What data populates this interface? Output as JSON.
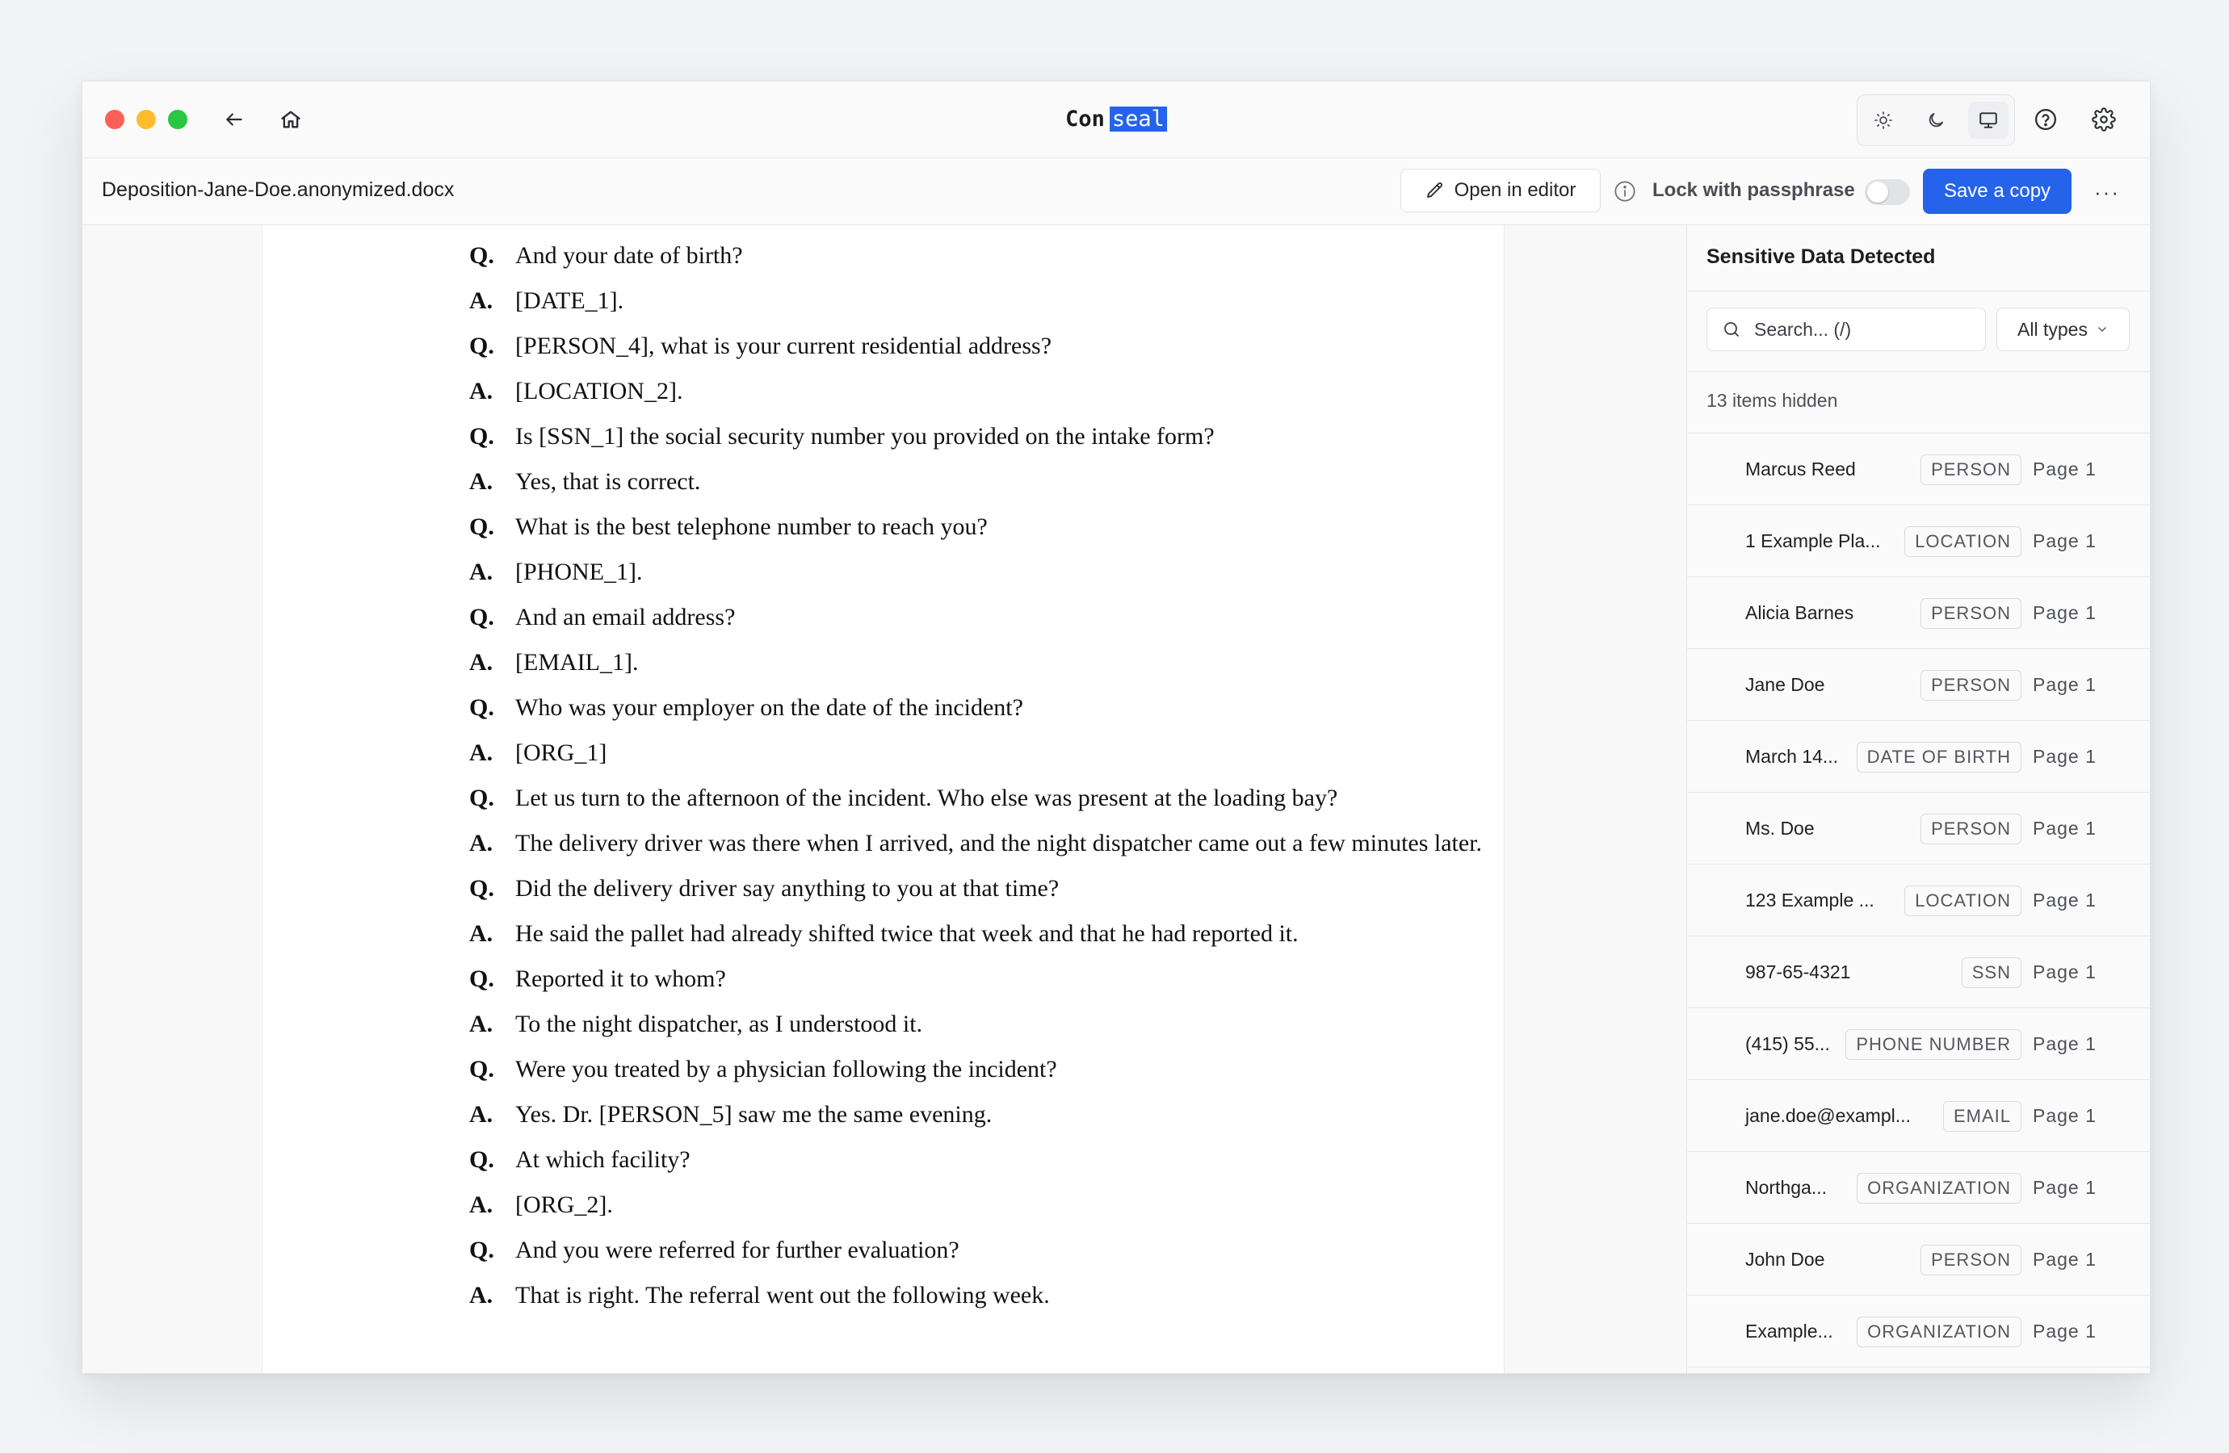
{
  "app": {
    "brand_left": "Con",
    "brand_right": "seal"
  },
  "toolbar": {
    "filename": "Deposition-Jane-Doe.anonymized.docx",
    "open_in_editor": "Open in editor",
    "lock_label": "Lock with passphrase",
    "lock_enabled": false,
    "save_copy": "Save a copy",
    "more": "···"
  },
  "document": {
    "lines": [
      {
        "marker": "Q.",
        "text": "And your date of birth?"
      },
      {
        "marker": "A.",
        "text": "[DATE_1]."
      },
      {
        "marker": "Q.",
        "text": "[PERSON_4], what is your current residential address?"
      },
      {
        "marker": "A.",
        "text": "[LOCATION_2]."
      },
      {
        "marker": "Q.",
        "text": "Is [SSN_1] the social security number you provided on the intake form?"
      },
      {
        "marker": "A.",
        "text": "Yes, that is correct."
      },
      {
        "marker": "Q.",
        "text": "What is the best telephone number to reach you?"
      },
      {
        "marker": "A.",
        "text": "[PHONE_1]."
      },
      {
        "marker": "Q.",
        "text": "And an email address?"
      },
      {
        "marker": "A.",
        "text": "[EMAIL_1]."
      },
      {
        "marker": "Q.",
        "text": "Who was your employer on the date of the incident?"
      },
      {
        "marker": "A.",
        "text": "[ORG_1]"
      },
      {
        "marker": "Q.",
        "text": "Let us turn to the afternoon of the incident. Who else was present at the loading bay?"
      },
      {
        "marker": "A.",
        "text": "The delivery driver was there when I arrived, and the night dispatcher came out a few minutes later."
      },
      {
        "marker": "Q.",
        "text": "Did the delivery driver say anything to you at that time?"
      },
      {
        "marker": "A.",
        "text": "He said the pallet had already shifted twice that week and that he had reported it."
      },
      {
        "marker": "Q.",
        "text": "Reported it to whom?"
      },
      {
        "marker": "A.",
        "text": "To the night dispatcher, as I understood it."
      },
      {
        "marker": "Q.",
        "text": "Were you treated by a physician following the incident?"
      },
      {
        "marker": "A.",
        "text": "Yes. Dr. [PERSON_5] saw me the same evening."
      },
      {
        "marker": "Q.",
        "text": "At which facility?"
      },
      {
        "marker": "A.",
        "text": "[ORG_2]."
      },
      {
        "marker": "Q.",
        "text": "And you were referred for further evaluation?"
      },
      {
        "marker": "A.",
        "text": "That is right. The referral went out the following week."
      }
    ]
  },
  "sidebar": {
    "title": "Sensitive Data Detected",
    "search_placeholder": "Search... (/)",
    "filter_label": "All types",
    "hidden_count": "13 items hidden",
    "items": [
      {
        "name": "Marcus Reed",
        "type": "PERSON",
        "page": "Page 1"
      },
      {
        "name": "1 Example Pla...",
        "type": "LOCATION",
        "page": "Page 1"
      },
      {
        "name": "Alicia Barnes",
        "type": "PERSON",
        "page": "Page 1"
      },
      {
        "name": "Jane Doe",
        "type": "PERSON",
        "page": "Page 1"
      },
      {
        "name": "March 14...",
        "type": "DATE OF BIRTH",
        "page": "Page 1"
      },
      {
        "name": "Ms. Doe",
        "type": "PERSON",
        "page": "Page 1"
      },
      {
        "name": "123 Example ...",
        "type": "LOCATION",
        "page": "Page 1"
      },
      {
        "name": "987-65-4321",
        "type": "SSN",
        "page": "Page 1"
      },
      {
        "name": "(415) 55...",
        "type": "PHONE NUMBER",
        "page": "Page 1"
      },
      {
        "name": "jane.doe@exampl...",
        "type": "EMAIL",
        "page": "Page 1"
      },
      {
        "name": "Northga...",
        "type": "ORGANIZATION",
        "page": "Page 1"
      },
      {
        "name": "John Doe",
        "type": "PERSON",
        "page": "Page 1"
      },
      {
        "name": "Example...",
        "type": "ORGANIZATION",
        "page": "Page 1"
      }
    ]
  },
  "colors": {
    "accent": "#2563eb",
    "traffic_red": "#ff5f57",
    "traffic_yellow": "#febc2e",
    "traffic_green": "#28c840"
  },
  "icons": [
    "back-arrow-icon",
    "home-icon",
    "sun-icon",
    "moon-icon",
    "monitor-icon",
    "help-icon",
    "gear-icon",
    "pencil-icon",
    "info-icon",
    "search-icon",
    "chevron-down-icon"
  ]
}
